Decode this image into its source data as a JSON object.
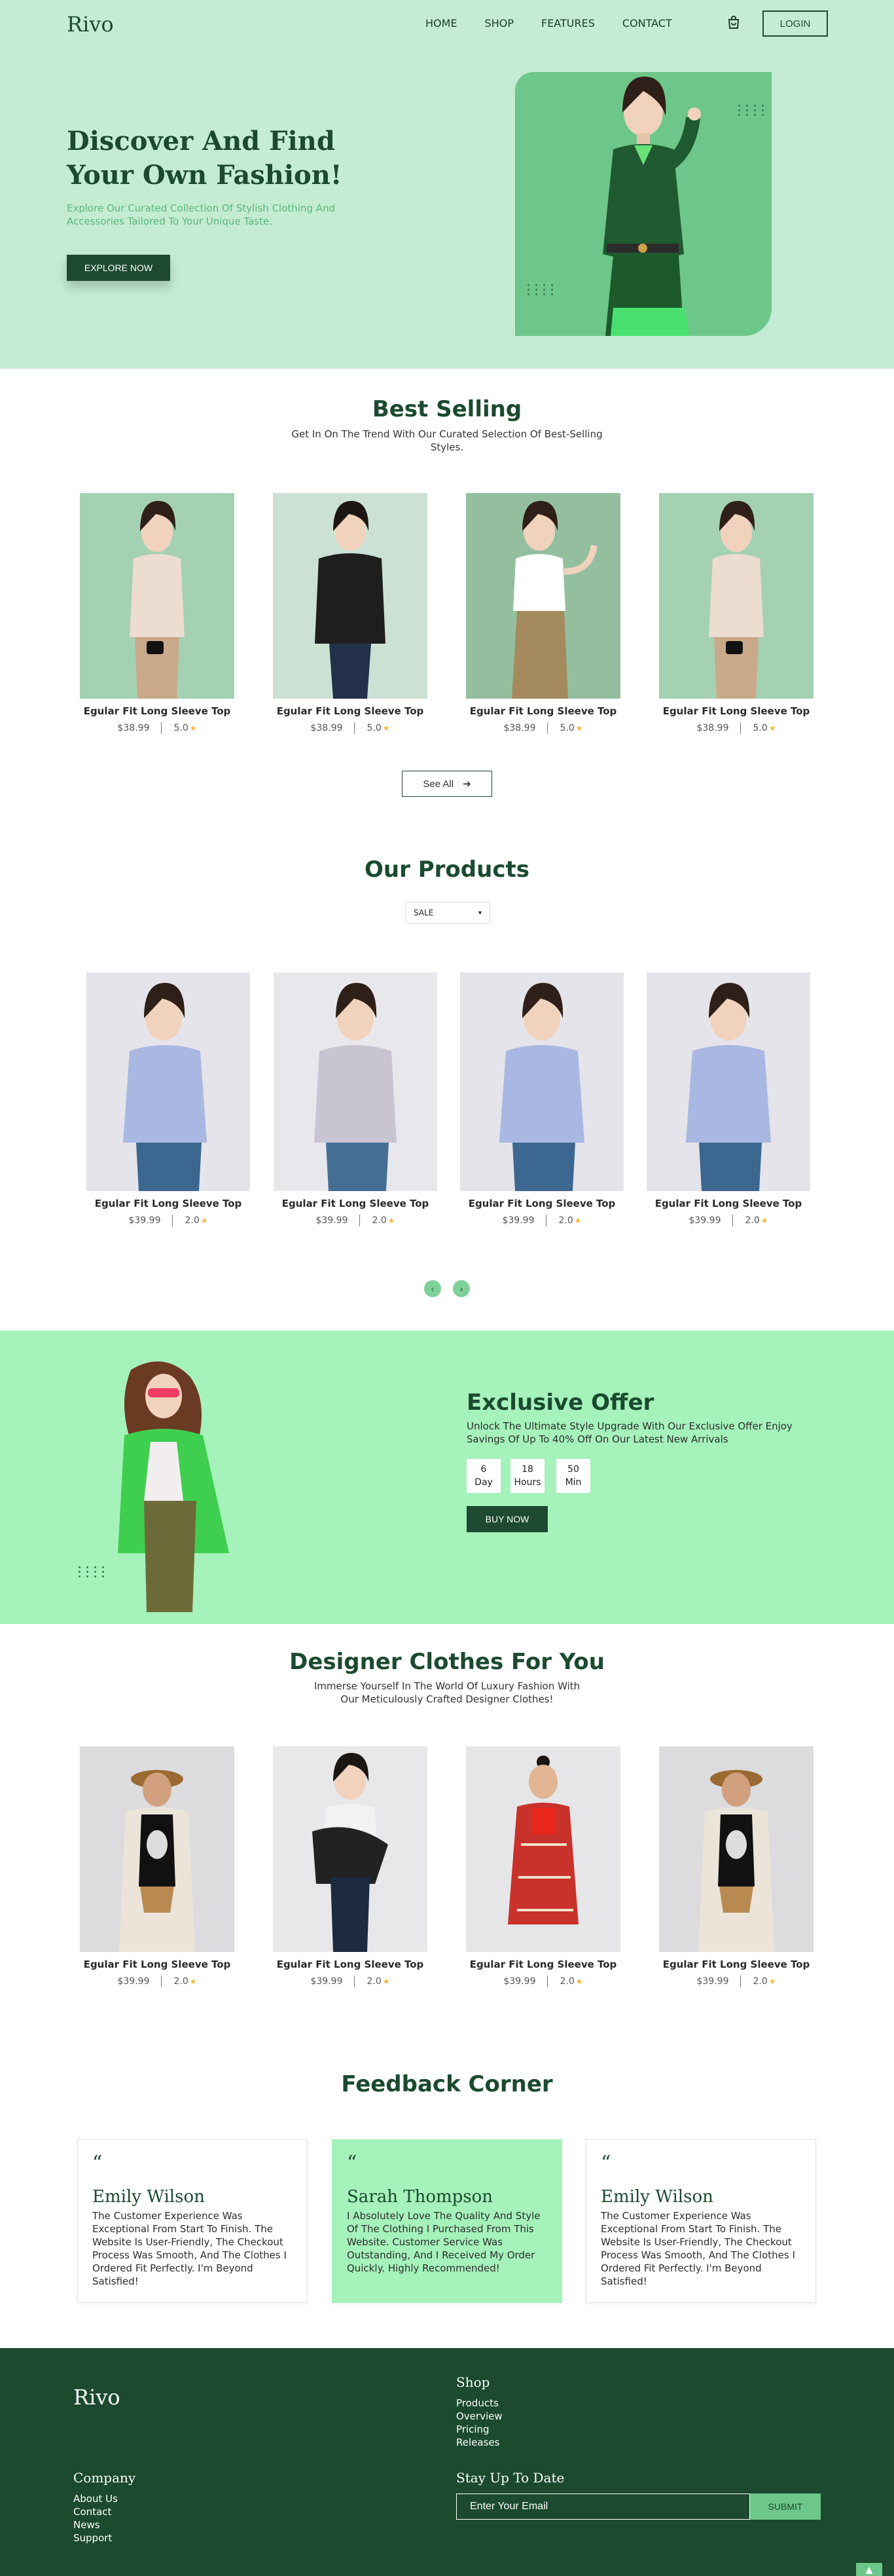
{
  "brand": "Rivo",
  "nav": [
    "HOME",
    "SHOP",
    "FEATURES",
    "CONTACT"
  ],
  "login": "LOGIN",
  "hero": {
    "title": "Discover And Find Your Own Fashion!",
    "subtitle": "Explore Our Curated Collection Of Stylish Clothing And Accessories Tailored To Your Unique Taste.",
    "cta": "EXPLORE NOW"
  },
  "best_selling": {
    "title": "Best Selling",
    "subtitle": "Get In On The Trend With Our Curated Selection Of Best-Selling Styles.",
    "items": [
      {
        "name": "Egular Fit Long Sleeve Top",
        "price": "$38.99",
        "rating": "5.0"
      },
      {
        "name": "Egular Fit Long Sleeve Top",
        "price": "$38.99",
        "rating": "5.0"
      },
      {
        "name": "Egular Fit Long Sleeve Top",
        "price": "$38.99",
        "rating": "5.0"
      },
      {
        "name": "Egular Fit Long Sleeve Top",
        "price": "$38.99",
        "rating": "5.0"
      }
    ],
    "see_all": "See All"
  },
  "our_products": {
    "title": "Our Products",
    "filter": "SALE",
    "items": [
      {
        "name": "Egular Fit Long Sleeve Top",
        "price": "$39.99",
        "rating": "2.0"
      },
      {
        "name": "Egular Fit Long Sleeve Top",
        "price": "$39.99",
        "rating": "2.0"
      },
      {
        "name": "Egular Fit Long Sleeve Top",
        "price": "$39.99",
        "rating": "2.0"
      },
      {
        "name": "Egular Fit Long Sleeve Top",
        "price": "$39.99",
        "rating": "2.0"
      }
    ]
  },
  "offer": {
    "title": "Exclusive Offer",
    "subtitle": "Unlock The Ultimate Style Upgrade With Our Exclusive Offer Enjoy Savings Of Up To 40% Off On Our Latest New Arrivals",
    "countdown": [
      {
        "value": "6",
        "unit": "Day"
      },
      {
        "value": "18",
        "unit": "Hours"
      },
      {
        "value": "50",
        "unit": "Min"
      }
    ],
    "cta": "BUY NOW"
  },
  "designer": {
    "title": "Designer Clothes For You",
    "subtitle": "Immerse Yourself In The World Of Luxury Fashion With Our Meticulously Crafted Designer Clothes!",
    "items": [
      {
        "name": "Egular Fit Long Sleeve Top",
        "price": "$39.99",
        "rating": "2.0"
      },
      {
        "name": "Egular Fit Long Sleeve Top",
        "price": "$39.99",
        "rating": "2.0"
      },
      {
        "name": "Egular Fit Long Sleeve Top",
        "price": "$39.99",
        "rating": "2.0"
      },
      {
        "name": "Egular Fit Long Sleeve Top",
        "price": "$39.99",
        "rating": "2.0"
      }
    ]
  },
  "feedback": {
    "title": "Feedback Corner",
    "items": [
      {
        "name": "Emily Wilson",
        "text": "The Customer Experience Was Exceptional From Start To Finish. The Website Is User-Friendly, The Checkout Process Was Smooth, And The Clothes I Ordered Fit Perfectly. I'm Beyond Satisfied!"
      },
      {
        "name": "Sarah Thompson",
        "text": "I Absolutely Love The Quality And Style Of The Clothing I Purchased From This Website. Customer Service Was Outstanding, And I Received My Order Quickly. Highly Recommended!"
      },
      {
        "name": "Emily Wilson",
        "text": "The Customer Experience Was Exceptional From Start To Finish. The Website Is User-Friendly, The Checkout Process Was Smooth, And The Clothes I Ordered Fit Perfectly. I'm Beyond Satisfied!"
      }
    ]
  },
  "footer": {
    "brand": "Rivo",
    "shop_title": "Shop",
    "shop_links": [
      "Products",
      "Overview",
      "Pricing",
      "Releases"
    ],
    "company_title": "Company",
    "company_links": [
      "About Us",
      "Contact",
      "News",
      "Support"
    ],
    "newsletter_title": "Stay Up To Date",
    "email_placeholder": "Enter Your Email",
    "submit": "SUBMIT"
  },
  "colors": {
    "dark_green": "#1b4a2f",
    "mint": "#c3ecd2",
    "bright_mint": "#a5f2bb",
    "accent": "#6ec78a",
    "star": "#f3b73b"
  },
  "icons": [
    "cart-icon",
    "arrow-right-icon",
    "chevron-down-icon",
    "chevron-left-icon",
    "chevron-right-icon",
    "star-icon",
    "quote-icon",
    "arrow-up-icon"
  ]
}
